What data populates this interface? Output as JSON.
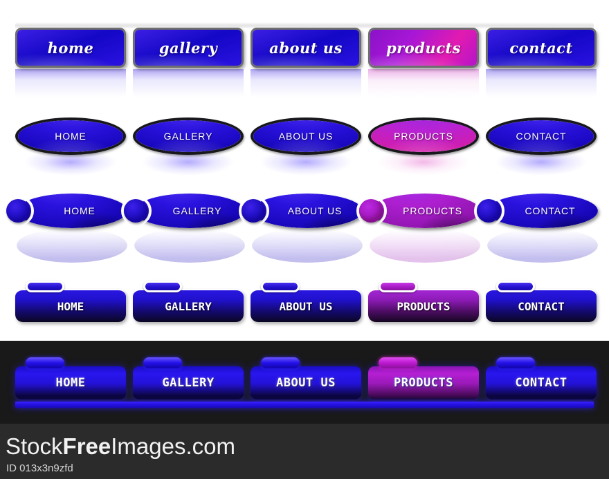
{
  "colors": {
    "blue": "#1a0fd8",
    "blue_light": "#3c1fe4",
    "magenta": "#c21bbe",
    "purple": "#a717d6",
    "dark_band": "#19191a",
    "footer_bg": "#2b2b2b",
    "button_border": "#6e6e6e",
    "white": "#ffffff"
  },
  "rows": [
    {
      "id": "row1",
      "style": "rectangular-script",
      "buttons": [
        {
          "label": "home",
          "accent": "blue"
        },
        {
          "label": "gallery",
          "accent": "blue"
        },
        {
          "label": "about us",
          "accent": "blue"
        },
        {
          "label": "products",
          "accent": "magenta"
        },
        {
          "label": "contact",
          "accent": "blue"
        }
      ]
    },
    {
      "id": "row2",
      "style": "ellipse-glow",
      "buttons": [
        {
          "label": "HOME",
          "accent": "blue"
        },
        {
          "label": "GALLERY",
          "accent": "blue"
        },
        {
          "label": "ABOUT US",
          "accent": "blue"
        },
        {
          "label": "PRODUCTS",
          "accent": "magenta"
        },
        {
          "label": "CONTACT",
          "accent": "blue"
        }
      ]
    },
    {
      "id": "row3",
      "style": "ellipse-circle-mirror",
      "buttons": [
        {
          "label": "HOME",
          "accent": "blue"
        },
        {
          "label": "GALLERY",
          "accent": "blue"
        },
        {
          "label": "ABOUT US",
          "accent": "blue"
        },
        {
          "label": "PRODUCTS",
          "accent": "magenta"
        },
        {
          "label": "CONTACT",
          "accent": "blue"
        }
      ]
    },
    {
      "id": "row4",
      "style": "rounded-tab-light",
      "buttons": [
        {
          "label": "HOME",
          "accent": "blue"
        },
        {
          "label": "GALLERY",
          "accent": "blue"
        },
        {
          "label": "ABOUT US",
          "accent": "blue"
        },
        {
          "label": "PRODUCTS",
          "accent": "magenta"
        },
        {
          "label": "CONTACT",
          "accent": "blue"
        }
      ]
    },
    {
      "id": "row5",
      "style": "rounded-tab-dark",
      "buttons": [
        {
          "label": "HOME",
          "accent": "blue"
        },
        {
          "label": "GALLERY",
          "accent": "blue"
        },
        {
          "label": "ABOUT US",
          "accent": "blue"
        },
        {
          "label": "PRODUCTS",
          "accent": "magenta"
        },
        {
          "label": "CONTACT",
          "accent": "blue"
        }
      ]
    }
  ],
  "footer": {
    "brand_part1": "Stock",
    "brand_part2": "Free",
    "brand_part3": "Images.com",
    "id_label": "ID 013x3n9zfd"
  }
}
